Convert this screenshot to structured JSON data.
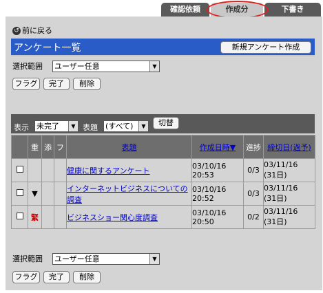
{
  "tabs": [
    {
      "label": "確認依頼"
    },
    {
      "label": "作成分"
    },
    {
      "label": "下書き"
    }
  ],
  "back_label": "前に戻る",
  "page_title": "アンケート一覧",
  "new_button": "新規アンケート作成",
  "top_select": {
    "label": "選択範囲",
    "value": "ユーザー任意"
  },
  "bottom_select": {
    "label": "選択範囲",
    "value": "ユーザー任意"
  },
  "actions": {
    "flag": "フラグ",
    "done": "完了",
    "delete": "削除"
  },
  "filters": {
    "display_label": "表示",
    "display_value": "未完了",
    "subject_label": "表題",
    "subject_value": "(すべて)",
    "switch_label": "切替"
  },
  "columns": {
    "check": "",
    "importance": "重",
    "attachment": "添",
    "flag": "フ",
    "subject": "表題",
    "created": "作成日時▼",
    "progress": "進捗",
    "deadline": "締切日(過予)"
  },
  "rows": [
    {
      "importance": "",
      "subject": "健康に関するアンケート",
      "created_date": "03/10/16",
      "created_time": "20:53",
      "progress": "0/3",
      "deadline_date": "03/11/16",
      "deadline_days": "(31日)"
    },
    {
      "importance": "▼",
      "subject": "インターネットビジネスについての調査",
      "created_date": "03/10/16",
      "created_time": "20:52",
      "progress": "0/3",
      "deadline_date": "03/11/16",
      "deadline_days": "(31日)"
    },
    {
      "importance": "緊",
      "subject": "ビジネスショー関心度調査",
      "created_date": "03/10/16",
      "created_time": "20:50",
      "progress": "0/2",
      "deadline_date": "03/11/16",
      "deadline_days": "(31日)"
    }
  ],
  "colors": {
    "title_bar": "#2a5cc8",
    "panel": "#d4d4d4",
    "header": "#6e6e6e",
    "highlight": "#e02020"
  }
}
